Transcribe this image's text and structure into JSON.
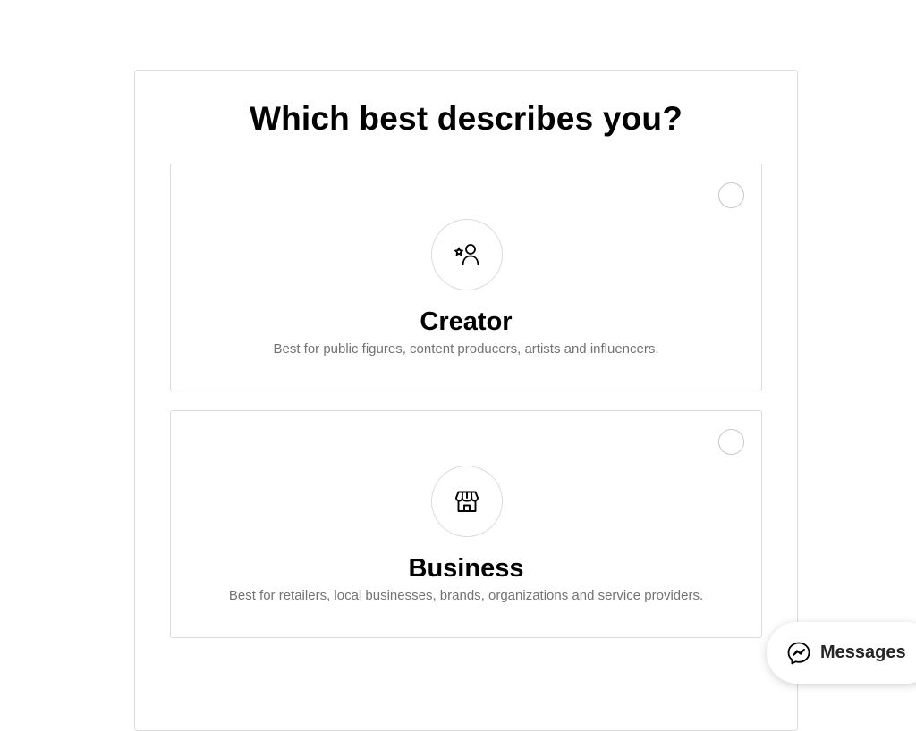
{
  "page": {
    "title": "Which best describes you?"
  },
  "options": [
    {
      "title": "Creator",
      "description": "Best for public figures, content producers, artists and influencers.",
      "icon": "star-person-icon",
      "selected": false
    },
    {
      "title": "Business",
      "description": "Best for retailers, local businesses, brands, organizations and service providers.",
      "icon": "storefront-icon",
      "selected": false
    }
  ],
  "messages": {
    "label": "Messages",
    "icon": "messenger-icon"
  },
  "colors": {
    "border": "#dbdbdb",
    "text_primary": "#000000",
    "text_secondary": "#737373"
  }
}
